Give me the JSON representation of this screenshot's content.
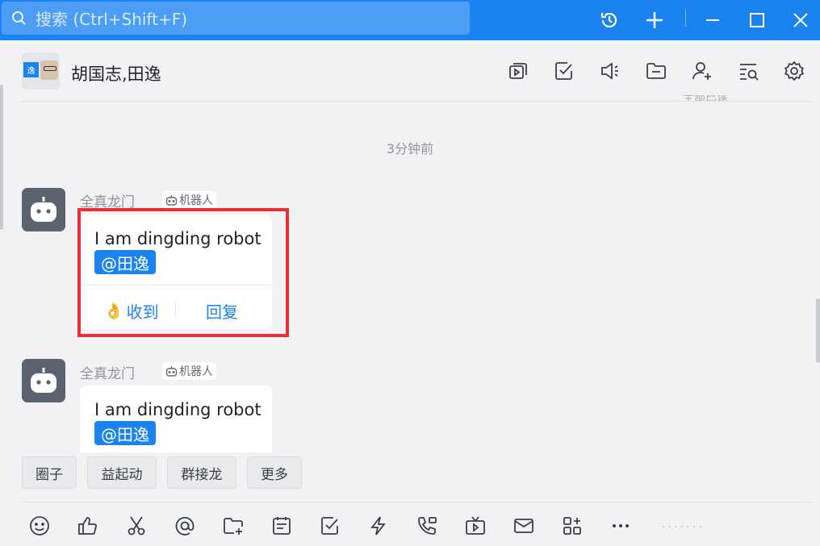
{
  "search": {
    "placeholder": "搜索 (Ctrl+Shift+F)"
  },
  "window_controls": [
    "history-icon",
    "plus-icon",
    "minimize-icon",
    "maximize-icon",
    "close-icon"
  ],
  "chat": {
    "title": "胡国志,田逸",
    "avatar_badge": "逸",
    "header_icons": [
      "video-folder-icon",
      "todo-check-icon",
      "announcement-icon",
      "folder-icon",
      "add-member-icon",
      "search-history-icon",
      "settings-icon"
    ],
    "partial_text": "全部已读"
  },
  "time_divider": "3分钟前",
  "messages": [
    {
      "sender": "全真龙门",
      "tag": "机器人",
      "text": "I am dingding robot",
      "mention": "@田逸",
      "actions": {
        "ack": "收到",
        "reply": "回复"
      }
    },
    {
      "sender": "全真龙门",
      "tag": "机器人",
      "text": "I am dingding robot",
      "mention": "@田逸"
    }
  ],
  "chips": [
    "圈子",
    "益起动",
    "群接龙",
    "更多"
  ],
  "toolbar": [
    "emoji-icon",
    "thumbs-up-icon",
    "scissors-icon",
    "at-icon",
    "folder-plus-icon",
    "calendar-icon",
    "todo-icon",
    "flash-icon",
    "phone-icon",
    "live-tv-icon",
    "mail-icon",
    "apps-icon",
    "more-icon"
  ],
  "colors": {
    "accent": "#1a83f0",
    "highlight": "#e5303a",
    "bot_avatar": "#5b6270"
  }
}
